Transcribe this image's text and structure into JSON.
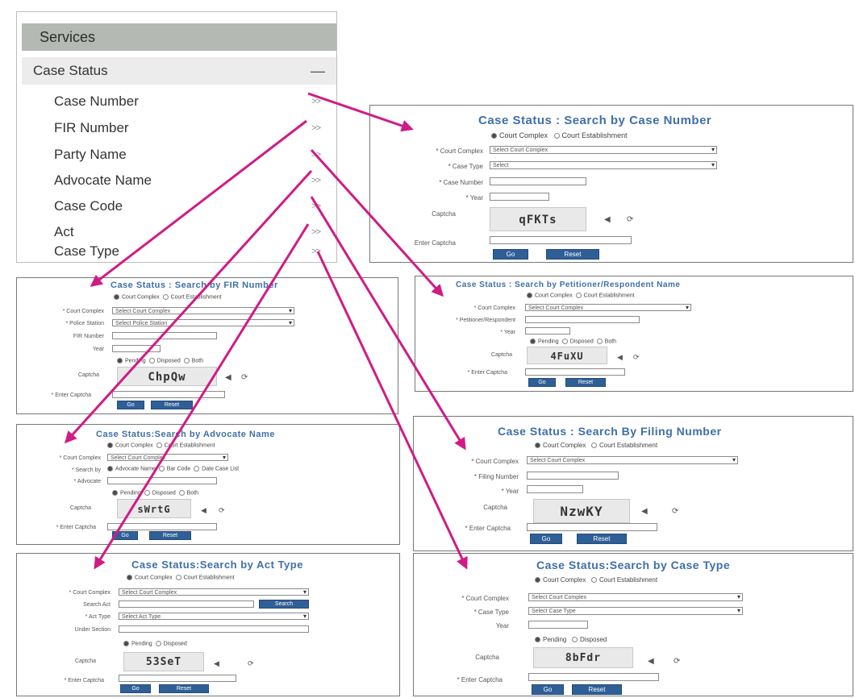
{
  "menu": {
    "header": "Services",
    "section": "Case Status",
    "section_toggle": "—",
    "chevron": ">>",
    "items": [
      "Case Number",
      "FIR Number",
      "Party Name",
      "Advocate Name",
      "Case Code",
      "Act",
      "Case Type"
    ]
  },
  "panels": {
    "case_number": {
      "title": "Case Status : Search by Case Number",
      "radio_1": "Court Complex",
      "radio_2": "Court Establishment",
      "label_court": "* Court Complex",
      "court_select": "Select Court Complex",
      "label_type": "* Case Type",
      "type_select": "Select",
      "label_number": "* Case Number",
      "label_year": "* Year",
      "label_captcha": "Captcha",
      "captcha": "qFKTs",
      "label_enter": "Enter Captcha",
      "go": "Go",
      "reset": "Reset"
    },
    "fir": {
      "title": "Case Status : Search by FIR Number",
      "radio_1": "Court Complex",
      "radio_2": "Court Establishment",
      "label_court": "* Court Complex",
      "court_select": "Select Court Complex",
      "label_police": "* Police Station",
      "police_select": "Select Police Station",
      "label_fir": "FIR Number",
      "label_year": "Year",
      "status_1": "Pending",
      "status_2": "Disposed",
      "status_3": "Both",
      "label_captcha": "Captcha",
      "captcha": "ChpQw",
      "label_enter": "* Enter Captcha",
      "go": "Go",
      "reset": "Reset"
    },
    "party": {
      "title": "Case Status : Search by Petitioner/Respondent Name",
      "radio_1": "Court Complex",
      "radio_2": "Court Establishment",
      "label_court": "* Court Complex",
      "court_select": "Select Court Complex",
      "label_party": "* Petitioner/Respondent",
      "label_year": "* Year",
      "status_1": "Pending",
      "status_2": "Disposed",
      "status_3": "Both",
      "label_captcha": "Captcha",
      "captcha": "4FuXU",
      "label_enter": "* Enter Captcha",
      "go": "Go",
      "reset": "Reset"
    },
    "advocate": {
      "title": "Case Status:Search by Advocate Name",
      "radio_1": "Court Complex",
      "radio_2": "Court Establishment",
      "label_court": "* Court Complex",
      "court_select": "Select Court Complex",
      "label_search": "* Search by",
      "search_1": "Advocate Name",
      "search_2": "Bar Code",
      "search_3": "Date Case List",
      "label_advocate": "* Advocate",
      "status_1": "Pending",
      "status_2": "Disposed",
      "status_3": "Both",
      "label_captcha": "Captcha",
      "captcha": "sWrtG",
      "label_enter": "* Enter Captcha",
      "go": "Go",
      "reset": "Reset"
    },
    "filing": {
      "title": "Case Status : Search By Filing Number",
      "radio_1": "Court Complex",
      "radio_2": "Court Establishment",
      "label_court": "* Court Complex",
      "court_select": "Select Court Complex",
      "label_filing": "* Filing Number",
      "label_year": "* Year",
      "label_captcha": "Captcha",
      "captcha": "NzwKY",
      "label_enter": "* Enter Captcha",
      "go": "Go",
      "reset": "Reset"
    },
    "act": {
      "title": "Case Status:Search by Act Type",
      "radio_1": "Court Complex",
      "radio_2": "Court Establishment",
      "label_court": "* Court Complex",
      "court_select": "Select Court Complex",
      "label_search_act": "Search Act",
      "search_btn": "Search",
      "label_act": "* Act Type",
      "act_select": "Select Act Type",
      "label_section": "Under Section",
      "status_1": "Pending",
      "status_2": "Disposed",
      "label_captcha": "Captcha",
      "captcha": "53SeT",
      "label_enter": "* Enter Captcha",
      "go": "Go",
      "reset": "Reset"
    },
    "case_type": {
      "title": "Case Status:Search by Case Type",
      "radio_1": "Court Complex",
      "radio_2": "Court Establishment",
      "label_court": "* Court Complex",
      "court_select": "Select Court Complex",
      "label_type": "* Case Type",
      "type_select": "Select Case Type",
      "label_year": "Year",
      "status_1": "Pending",
      "status_2": "Disposed",
      "label_captcha": "Captcha",
      "captcha": "8bFdr",
      "label_enter": "* Enter Captcha",
      "go": "Go",
      "reset": "Reset"
    }
  },
  "colors": {
    "arrow": "#d01b85",
    "title": "#3f6fa8",
    "button": "#2f5f97",
    "menu_header": "#b4b9b4"
  },
  "icons": {
    "audio": "speaker-icon",
    "refresh": "refresh-icon"
  }
}
